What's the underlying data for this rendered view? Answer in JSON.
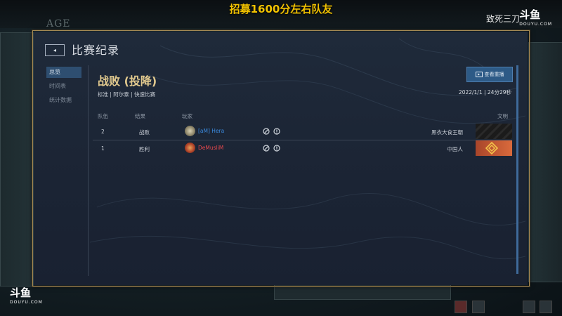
{
  "stream": {
    "title": "招募1600分左右队友",
    "streamer": "致死三刀",
    "brand": "斗鱼",
    "brand_sub": "DOUYU.COM"
  },
  "game": {
    "logo": "AGE"
  },
  "dialog": {
    "title": "比赛纪录",
    "sidebar": [
      {
        "label": "总览",
        "active": true
      },
      {
        "label": "时间表",
        "active": false
      },
      {
        "label": "统计数据",
        "active": false
      }
    ],
    "result": "战败 (投降)",
    "mode": "标准 | 阿尔泰 | 快速比赛",
    "replay_button": "查看重播",
    "datetime": "2022/1/1 | 24分29秒",
    "columns": {
      "team": "队伍",
      "result": "结果",
      "player": "玩家",
      "civ": "文明"
    },
    "rows": [
      {
        "team": "2",
        "result": "战败",
        "player": "[aM] Hera",
        "civ": "黑衣大食王朝",
        "player_color": "#3a8be0"
      },
      {
        "team": "1",
        "result": "胜利",
        "player": "DeMusliM",
        "civ": "中国人",
        "player_color": "#e5484d"
      }
    ]
  },
  "colors": {
    "accent_gold": "#e1c98e",
    "replay_blue": "#2d5a86",
    "stream_yellow": "#f2c200"
  }
}
